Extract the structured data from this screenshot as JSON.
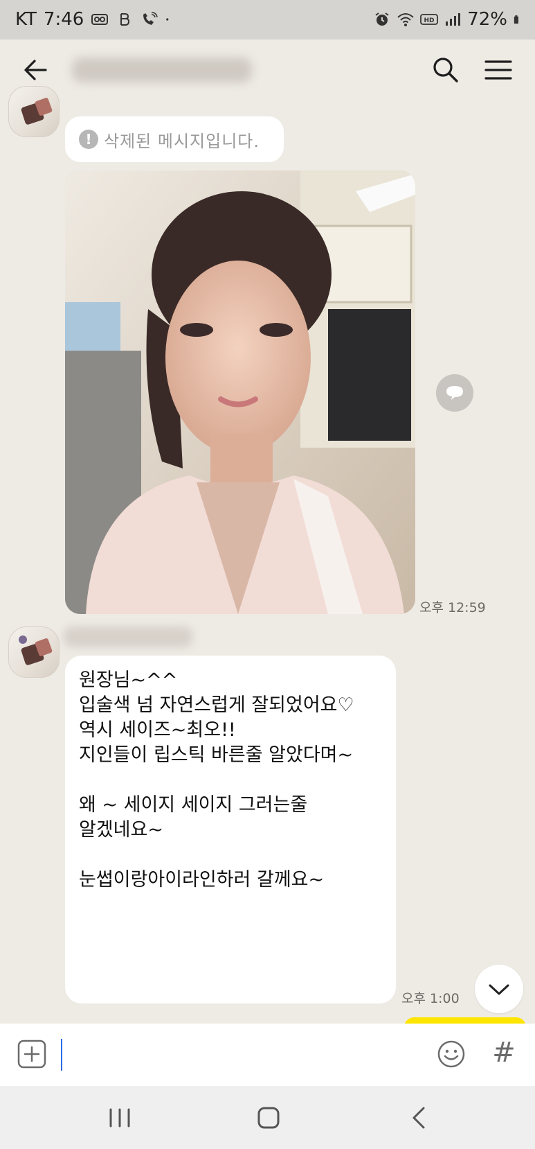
{
  "status_bar": {
    "carrier": "KT",
    "time": "7:46",
    "battery": "72%",
    "left_icons": [
      "voicemail-icon",
      "bluetooth-b-icon",
      "wifi-calling-icon",
      "dot-icon"
    ],
    "right_icons": [
      "alarm-icon",
      "wifi-icon",
      "hd-icon",
      "signal-icon",
      "battery-icon"
    ]
  },
  "header": {
    "back_icon": "arrow-left-icon",
    "search_icon": "search-icon",
    "menu_icon": "hamburger-menu-icon"
  },
  "messages": {
    "deleted_text": "삭제된 메시지입니다.",
    "photo_time": "오후 12:59",
    "text_message": "원장님~^^\n입술색 넘 자연스럽게 잘되었어요♡\n역시 세이즈~최오!!\n지인들이 립스틱 바른줄 알았다며~\n\n왜 ~ 세이지 세이지 그러는줄\n알겠네요~\n\n눈썹이랑아이라인하러 갈께요~",
    "text_time": "오후 1:00"
  },
  "input_bar": {
    "placeholder": "",
    "hash_label": "#"
  },
  "colors": {
    "background": "#eeebe5",
    "bubble": "#ffffff",
    "accent_yellow": "#fee500",
    "cursor": "#2b6ee8"
  }
}
